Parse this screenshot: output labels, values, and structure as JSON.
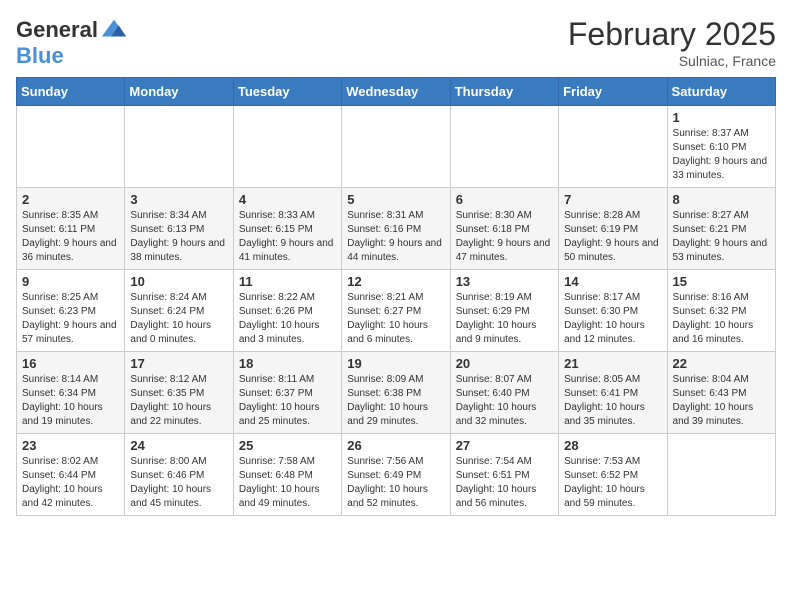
{
  "header": {
    "logo_general": "General",
    "logo_blue": "Blue",
    "title": "February 2025",
    "subtitle": "Sulniac, France"
  },
  "days_of_week": [
    "Sunday",
    "Monday",
    "Tuesday",
    "Wednesday",
    "Thursday",
    "Friday",
    "Saturday"
  ],
  "weeks": [
    [
      {
        "day": "",
        "info": ""
      },
      {
        "day": "",
        "info": ""
      },
      {
        "day": "",
        "info": ""
      },
      {
        "day": "",
        "info": ""
      },
      {
        "day": "",
        "info": ""
      },
      {
        "day": "",
        "info": ""
      },
      {
        "day": "1",
        "info": "Sunrise: 8:37 AM\nSunset: 6:10 PM\nDaylight: 9 hours and 33 minutes."
      }
    ],
    [
      {
        "day": "2",
        "info": "Sunrise: 8:35 AM\nSunset: 6:11 PM\nDaylight: 9 hours and 36 minutes."
      },
      {
        "day": "3",
        "info": "Sunrise: 8:34 AM\nSunset: 6:13 PM\nDaylight: 9 hours and 38 minutes."
      },
      {
        "day": "4",
        "info": "Sunrise: 8:33 AM\nSunset: 6:15 PM\nDaylight: 9 hours and 41 minutes."
      },
      {
        "day": "5",
        "info": "Sunrise: 8:31 AM\nSunset: 6:16 PM\nDaylight: 9 hours and 44 minutes."
      },
      {
        "day": "6",
        "info": "Sunrise: 8:30 AM\nSunset: 6:18 PM\nDaylight: 9 hours and 47 minutes."
      },
      {
        "day": "7",
        "info": "Sunrise: 8:28 AM\nSunset: 6:19 PM\nDaylight: 9 hours and 50 minutes."
      },
      {
        "day": "8",
        "info": "Sunrise: 8:27 AM\nSunset: 6:21 PM\nDaylight: 9 hours and 53 minutes."
      }
    ],
    [
      {
        "day": "9",
        "info": "Sunrise: 8:25 AM\nSunset: 6:23 PM\nDaylight: 9 hours and 57 minutes."
      },
      {
        "day": "10",
        "info": "Sunrise: 8:24 AM\nSunset: 6:24 PM\nDaylight: 10 hours and 0 minutes."
      },
      {
        "day": "11",
        "info": "Sunrise: 8:22 AM\nSunset: 6:26 PM\nDaylight: 10 hours and 3 minutes."
      },
      {
        "day": "12",
        "info": "Sunrise: 8:21 AM\nSunset: 6:27 PM\nDaylight: 10 hours and 6 minutes."
      },
      {
        "day": "13",
        "info": "Sunrise: 8:19 AM\nSunset: 6:29 PM\nDaylight: 10 hours and 9 minutes."
      },
      {
        "day": "14",
        "info": "Sunrise: 8:17 AM\nSunset: 6:30 PM\nDaylight: 10 hours and 12 minutes."
      },
      {
        "day": "15",
        "info": "Sunrise: 8:16 AM\nSunset: 6:32 PM\nDaylight: 10 hours and 16 minutes."
      }
    ],
    [
      {
        "day": "16",
        "info": "Sunrise: 8:14 AM\nSunset: 6:34 PM\nDaylight: 10 hours and 19 minutes."
      },
      {
        "day": "17",
        "info": "Sunrise: 8:12 AM\nSunset: 6:35 PM\nDaylight: 10 hours and 22 minutes."
      },
      {
        "day": "18",
        "info": "Sunrise: 8:11 AM\nSunset: 6:37 PM\nDaylight: 10 hours and 25 minutes."
      },
      {
        "day": "19",
        "info": "Sunrise: 8:09 AM\nSunset: 6:38 PM\nDaylight: 10 hours and 29 minutes."
      },
      {
        "day": "20",
        "info": "Sunrise: 8:07 AM\nSunset: 6:40 PM\nDaylight: 10 hours and 32 minutes."
      },
      {
        "day": "21",
        "info": "Sunrise: 8:05 AM\nSunset: 6:41 PM\nDaylight: 10 hours and 35 minutes."
      },
      {
        "day": "22",
        "info": "Sunrise: 8:04 AM\nSunset: 6:43 PM\nDaylight: 10 hours and 39 minutes."
      }
    ],
    [
      {
        "day": "23",
        "info": "Sunrise: 8:02 AM\nSunset: 6:44 PM\nDaylight: 10 hours and 42 minutes."
      },
      {
        "day": "24",
        "info": "Sunrise: 8:00 AM\nSunset: 6:46 PM\nDaylight: 10 hours and 45 minutes."
      },
      {
        "day": "25",
        "info": "Sunrise: 7:58 AM\nSunset: 6:48 PM\nDaylight: 10 hours and 49 minutes."
      },
      {
        "day": "26",
        "info": "Sunrise: 7:56 AM\nSunset: 6:49 PM\nDaylight: 10 hours and 52 minutes."
      },
      {
        "day": "27",
        "info": "Sunrise: 7:54 AM\nSunset: 6:51 PM\nDaylight: 10 hours and 56 minutes."
      },
      {
        "day": "28",
        "info": "Sunrise: 7:53 AM\nSunset: 6:52 PM\nDaylight: 10 hours and 59 minutes."
      },
      {
        "day": "",
        "info": ""
      }
    ]
  ]
}
